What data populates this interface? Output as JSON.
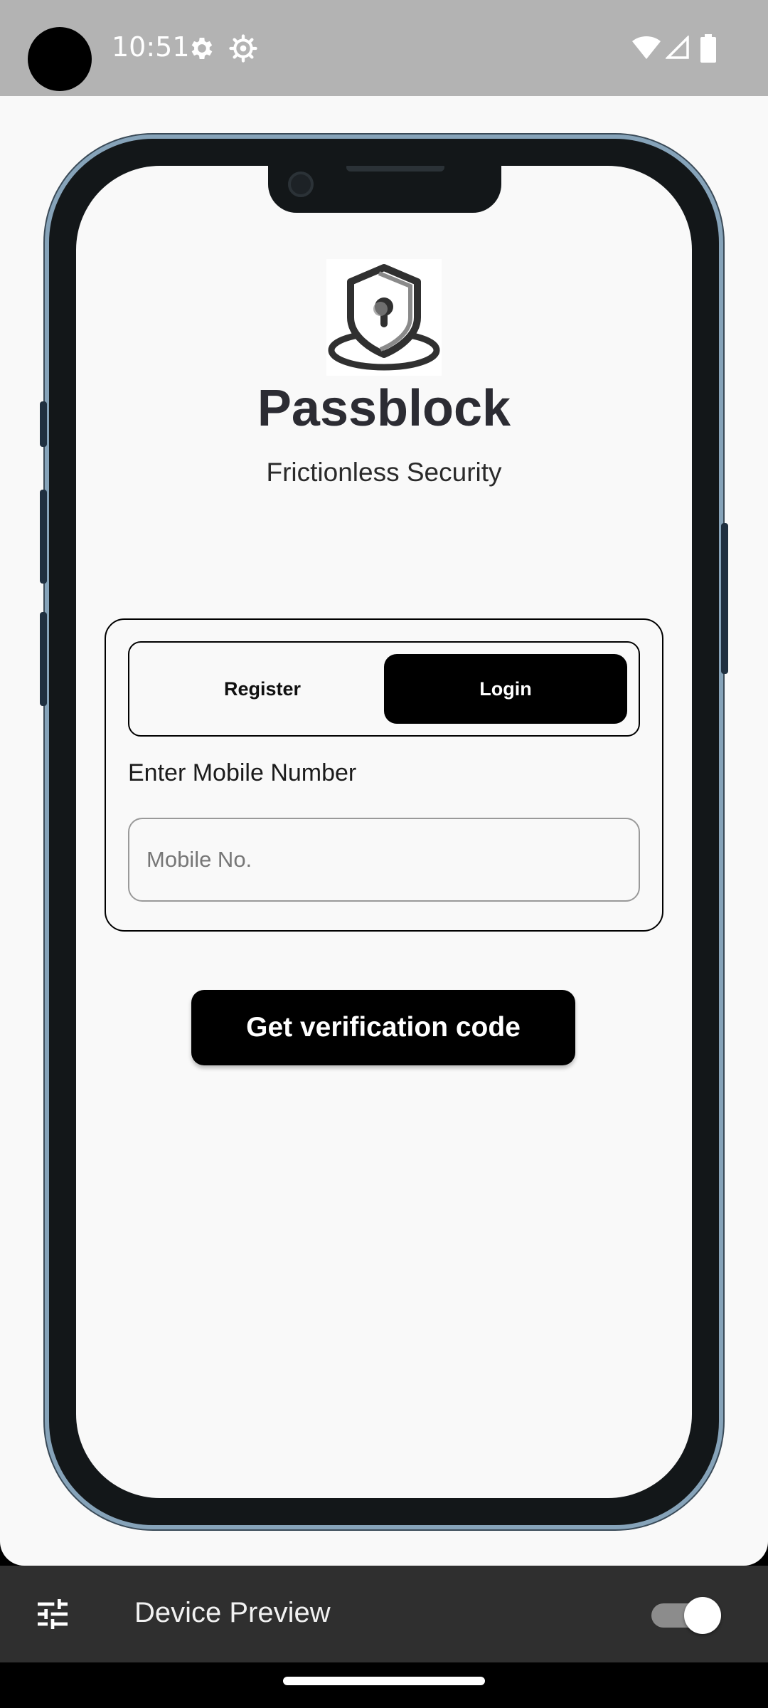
{
  "status_bar": {
    "time": "10:51",
    "left_icons": [
      "gear-icon",
      "settings-alt-icon"
    ],
    "right_icons": [
      "wifi-icon",
      "signal-icon",
      "battery-icon"
    ],
    "background": "#b3b3b3"
  },
  "app": {
    "name": "Passblock",
    "tagline": "Frictionless Security",
    "logo_icon": "keyhole-pin-icon",
    "tabs": {
      "register": "Register",
      "login": "Login",
      "selected": "Login"
    },
    "mobile_label": "Enter Mobile Number",
    "mobile_input": {
      "placeholder": "Mobile No.",
      "value": ""
    },
    "verify_button": "Get verification code",
    "accent": "#000000"
  },
  "device_preview": {
    "label": "Device Preview",
    "settings_icon": "tune-icon",
    "enabled": true
  },
  "colors": {
    "frame": "#131719",
    "frame_edge": "#86a3b9",
    "page": "#f9f9f9",
    "toolbar": "#2f2f2f"
  }
}
